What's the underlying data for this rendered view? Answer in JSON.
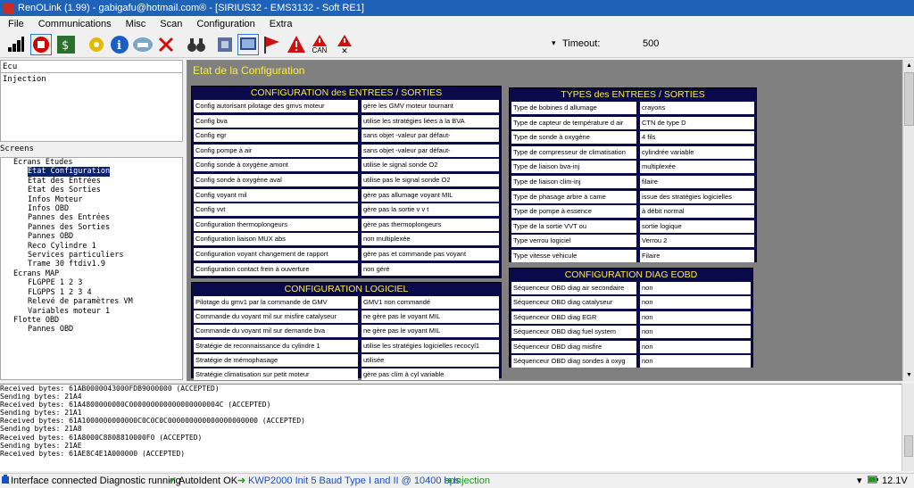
{
  "window": {
    "title": "RenOLink (1.99) - gabigafu@hotmail.com® - [SIRIUS32 - EMS3132 - Soft RE1]"
  },
  "menu": [
    "File",
    "Communications",
    "Misc",
    "Scan",
    "Configuration",
    "Extra"
  ],
  "toolbar": {
    "timeout_label": "Timeout:",
    "timeout_value": "500",
    "can_label": "CAN"
  },
  "ecu": {
    "header": "Ecu",
    "items": [
      "Injection"
    ]
  },
  "screens": {
    "label": "Screens",
    "tree": [
      {
        "text": "Ecrans Etudes",
        "indent": 1
      },
      {
        "text": "Etat Configuration",
        "indent": 2,
        "selected": true
      },
      {
        "text": "Etat des Entrées",
        "indent": 2
      },
      {
        "text": "Etat des Sorties",
        "indent": 2
      },
      {
        "text": "Infos Moteur",
        "indent": 2
      },
      {
        "text": "Infos OBD",
        "indent": 2
      },
      {
        "text": "Pannes des Entrées",
        "indent": 2
      },
      {
        "text": "Pannes des Sorties",
        "indent": 2
      },
      {
        "text": "Pannes OBD",
        "indent": 2
      },
      {
        "text": "Reco Cylindre 1",
        "indent": 2
      },
      {
        "text": "Services particuliers",
        "indent": 2
      },
      {
        "text": "Trame 30 ftdiv1.9",
        "indent": 2
      },
      {
        "text": "Ecrans MAP",
        "indent": 1
      },
      {
        "text": "FLGPPE 1 2 3",
        "indent": 2
      },
      {
        "text": "FLGPPS 1 2 3 4",
        "indent": 2
      },
      {
        "text": "Relevé de paramètres VM",
        "indent": 2
      },
      {
        "text": "Variables moteur 1",
        "indent": 2
      },
      {
        "text": "Flotte OBD",
        "indent": 1
      },
      {
        "text": "Pannes OBD",
        "indent": 2
      }
    ]
  },
  "main": {
    "title": "Etat de la Configuration",
    "es": {
      "title": "CONFIGURATION des ENTREES / SORTIES",
      "rows": [
        [
          "Config autorisant pilotage des gmvs moteur",
          "gère les GMV moteur tournant"
        ],
        [
          "Config bva",
          "utilise les stratégies liées à la BVA"
        ],
        [
          "Config egr",
          "sans objet -valeur par défaut-"
        ],
        [
          "Config pompe à air",
          "sans objet -valeur par défaut-"
        ],
        [
          "Config sonde à oxygène amont",
          "utilise le signal sonde O2"
        ],
        [
          "Config sonde à oxygène aval",
          "utilise pas le signal sonde O2"
        ],
        [
          "Config voyant mil",
          "gère pas allumage voyant MIL"
        ],
        [
          "Config vvt",
          "gère pas la sortie v v t"
        ],
        [
          "Configuration thermoplongeurs",
          "gère pas thermoplongeurs"
        ],
        [
          "Configuration liaison MUX abs",
          "non multiplexée"
        ],
        [
          "Configuration voyant changement de rapport",
          "gère pas et commande pas voyant"
        ],
        [
          "Configuration contact frein à ouverture",
          "non géré"
        ]
      ]
    },
    "logiciel": {
      "title": "CONFIGURATION LOGICIEL",
      "rows": [
        [
          "Pilotage du gmv1 par la commande de GMV",
          "GMV1 non commandé"
        ],
        [
          "Commande du voyant mil sur misfire catalyseur",
          "ne gère pas le voyant MIL"
        ],
        [
          "Commande du voyant mil sur demande bva",
          "ne gère pas le voyant MIL"
        ],
        [
          "Stratégie de reconnaissance du cylindre 1",
          "utilise les stratégies logicielles recocyl1"
        ],
        [
          "Stratégie de mémophasage",
          "utilisée"
        ],
        [
          "Stratégie climatisation sur petit moteur",
          "gère pas clim à cyl variable"
        ]
      ]
    },
    "types": {
      "title": "TYPES des ENTREES / SORTIES",
      "rows": [
        [
          "Type de bobines d allumage",
          "crayons"
        ],
        [
          "Type de capteur de température d air",
          "CTN de type D"
        ],
        [
          "Type de sonde à oxygène",
          "4 fils"
        ],
        [
          "Type de compresseur de climatisation",
          "cylindrée variable"
        ],
        [
          "Type de liaison bva-inj",
          "multiplexée"
        ],
        [
          "Type de liaison clim-inj",
          "filaire"
        ],
        [
          "Type de phasage arbre à came",
          "issue des stratégies logicielles"
        ],
        [
          "Type de pompe à essence",
          "à débit normal"
        ],
        [
          "Type de la sortie VVT ou",
          "sortie logique"
        ],
        [
          "Type verrou logiciel",
          "Verrou 2"
        ],
        [
          "Type vitesse véhicule",
          "Filaire"
        ]
      ]
    },
    "eobd": {
      "title": "CONFIGURATION DIAG EOBD",
      "rows": [
        [
          "Séquenceur OBD diag air secondaire",
          "non"
        ],
        [
          "Séquenceur OBD diag catalyseur",
          "non"
        ],
        [
          "Séquenceur OBD diag EGR",
          "non"
        ],
        [
          "Séquenceur OBD diag fuel system",
          "non"
        ],
        [
          "Séquenceur OBD diag misfire",
          "non"
        ],
        [
          "Séquenceur OBD diag sondes à oxyg",
          "non"
        ]
      ]
    }
  },
  "log": [
    "Received bytes: 61AB0000043000FDB9000000 (ACCEPTED)",
    "Sending bytes: 21A4",
    "Received bytes: 61A4800000000C000000000000000000004C (ACCEPTED)",
    "Sending bytes: 21A1",
    "Received bytes: 61A1000000000000C0C0C0C000000000000000000000 (ACCEPTED)",
    "Sending bytes: 21A8",
    "Received bytes: 61A8000C8808810000F0 (ACCEPTED)",
    "Sending bytes: 21AE",
    "Received bytes: 61AE8C4E1A000000 (ACCEPTED)"
  ],
  "status": {
    "connection": "Interface connected Diagnostic running",
    "autoident": "AutoIdent OK",
    "protocol": "KWP2000 Init 5 Baud Type I and II @ 10400 bps",
    "ecu": "Injection",
    "voltage": "12.1V",
    "colors": {
      "ok": "#1a9c1a",
      "protocol": "#1a4fc0",
      "ecu": "#1a9c1a"
    }
  }
}
